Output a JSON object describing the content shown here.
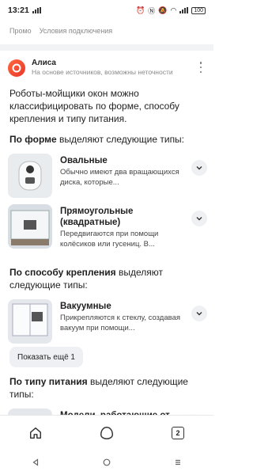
{
  "status_bar": {
    "time": "13:21",
    "battery": "100"
  },
  "top_links": [
    "Промо",
    "Условия подключения"
  ],
  "alice": {
    "name": "Алиса",
    "subtitle": "На основе источников, возможны неточности"
  },
  "answer": {
    "intro": "Роботы-мойщики окон можно классифицировать по форме, способу крепления и типу питания.",
    "section_form": {
      "bold": "По форме",
      "rest": " выделяют следующие типы:"
    },
    "section_mount": {
      "bold": "По способу крепления",
      "rest": " выделяют следующие типы:"
    },
    "section_power": {
      "bold": "По типу питания",
      "rest": " выделяют следующие типы:"
    },
    "items": [
      {
        "title": "Овальные",
        "desc": "Обычно имеют два вращающихся диска, которые..."
      },
      {
        "title": "Прямоугольные (квадратные)",
        "desc": "Передвигаются при помощи колёсиков или гусениц. В..."
      },
      {
        "title": "Вакуумные",
        "desc": "Прикрепляются к стеклу, создавая вакуум при помощи..."
      },
      {
        "title": "Модели, работающие от"
      }
    ],
    "show_more": "Показать ещё 1"
  },
  "bottom_nav": {
    "tabs_count": "2"
  },
  "colors": {
    "accent": "#e8362b",
    "chip_bg": "#eef0f3"
  }
}
